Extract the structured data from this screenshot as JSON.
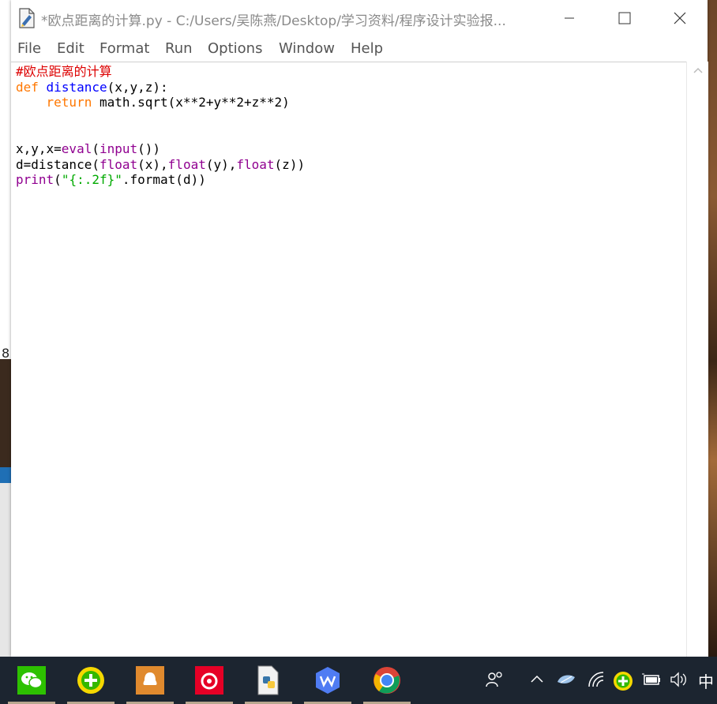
{
  "window": {
    "title": "*欧点距离的计算.py - C:/Users/吴陈燕/Desktop/学习资料/程序设计实验报..."
  },
  "menu": [
    "File",
    "Edit",
    "Format",
    "Run",
    "Options",
    "Window",
    "Help"
  ],
  "code": {
    "line1": "#欧点距离的计算",
    "line2_kw": "def",
    "line2_name": "distance",
    "line2_rest": "(x,y,z):",
    "line3_kw": "return",
    "line3_rest": " math.sqrt(x**2+y**2+z**2)",
    "line6_a": "x,y,x=",
    "line6_eval": "eval",
    "line6_paren": "(",
    "line6_input": "input",
    "line6_end": "())",
    "line7_a": "d=distance(",
    "line7_f1": "float",
    "line7_b": "(x),",
    "line7_f2": "float",
    "line7_c": "(y),",
    "line7_f3": "float",
    "line7_d": "(z))",
    "line8_print": "print",
    "line8_a": "(",
    "line8_str": "\"{:.2f}\"",
    "line8_b": ".format(d))"
  },
  "background": {
    "left_text": "8"
  },
  "taskbar": {
    "apps": [
      "wechat-icon",
      "green-plus-app-icon",
      "qq-icon",
      "netease-music-icon",
      "python-file-icon",
      "wps-icon",
      "browser-icon"
    ],
    "tray_ime": "中"
  }
}
